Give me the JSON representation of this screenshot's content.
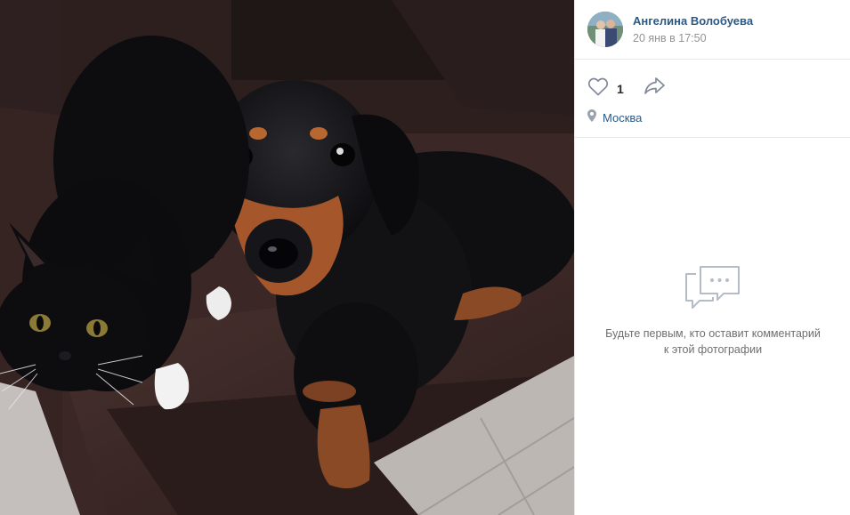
{
  "author": {
    "name": "Ангелина Волобуева",
    "date": "20 янв в 17:50"
  },
  "actions": {
    "like_count": "1",
    "like_icon": "heart-icon",
    "share_icon": "share-arrow-icon"
  },
  "place": {
    "icon": "map-pin-icon",
    "name": "Москва"
  },
  "comments": {
    "icon": "chat-bubbles-icon",
    "empty_text": "Будьте первым, кто оставит комментарий к этой фотографии"
  },
  "colors": {
    "link": "#2a5885",
    "muted": "#939393",
    "border": "#e7e8ec",
    "icon": "#828a99"
  }
}
